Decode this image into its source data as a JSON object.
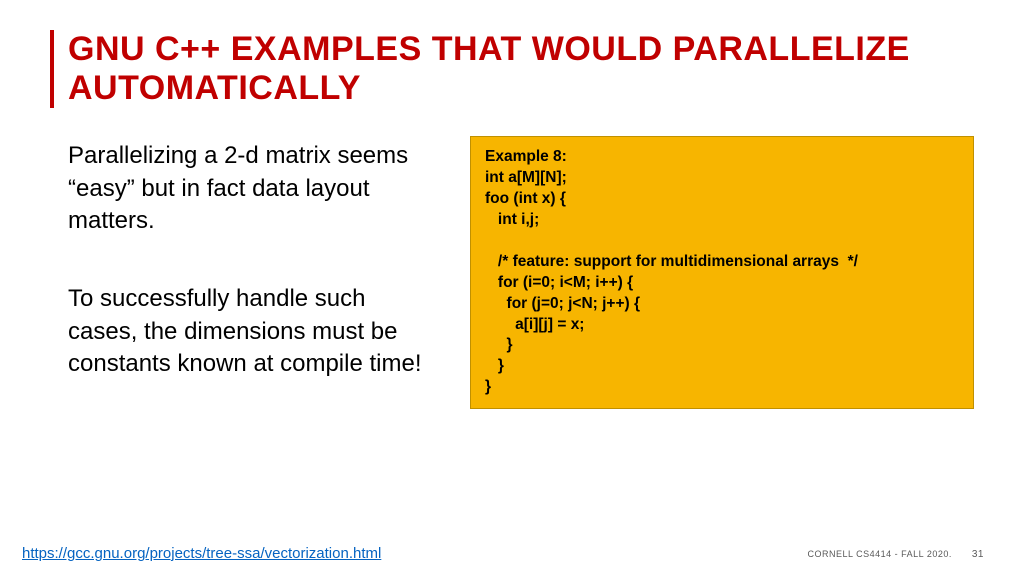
{
  "title": "GNU C++ EXAMPLES THAT WOULD PARALLELIZE AUTOMATICALLY",
  "body": {
    "para1": "Parallelizing a 2-d matrix seems “easy” but in fact data layout matters.",
    "para2": "To successfully handle such cases, the dimensions must be constants known at compile time!"
  },
  "code": "Example 8:\nint a[M][N];\nfoo (int x) {\n   int i,j;\n\n   /* feature: support for multidimensional arrays  */\n   for (i=0; i<M; i++) {\n     for (j=0; j<N; j++) {\n       a[i][j] = x;\n     }\n   }\n}",
  "footer": {
    "link": "https://gcc.gnu.org/projects/tree-ssa/vectorization.html",
    "course": "CORNELL CS4414 - FALL 2020.",
    "page": "31"
  }
}
